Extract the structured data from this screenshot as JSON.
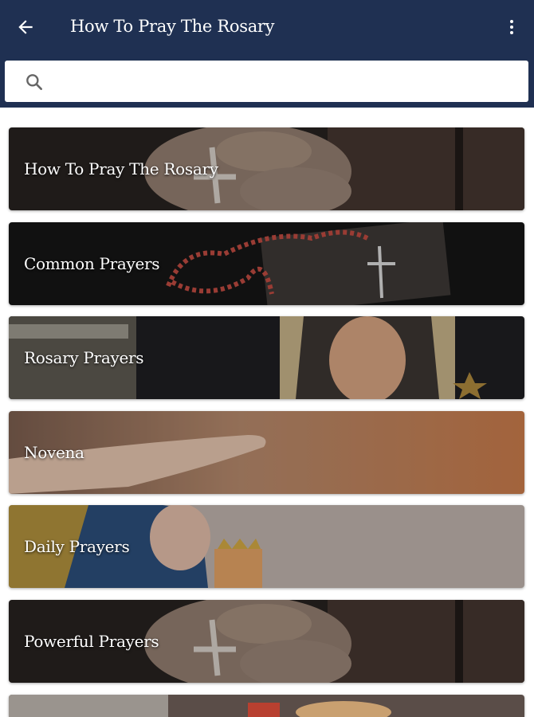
{
  "appbar": {
    "title": "How To Pray The Rosary",
    "back_icon": "arrow-left-icon",
    "menu_icon": "more-vert-icon"
  },
  "search": {
    "value": "",
    "placeholder": "",
    "icon": "search-icon"
  },
  "colors": {
    "appbar": "#1f3052",
    "card_text": "#ffffff"
  },
  "items": [
    {
      "label": "How To Pray The Rosary"
    },
    {
      "label": "Common Prayers"
    },
    {
      "label": "Rosary Prayers"
    },
    {
      "label": "Novena"
    },
    {
      "label": "Daily Prayers"
    },
    {
      "label": "Powerful Prayers"
    },
    {
      "label": ""
    }
  ]
}
